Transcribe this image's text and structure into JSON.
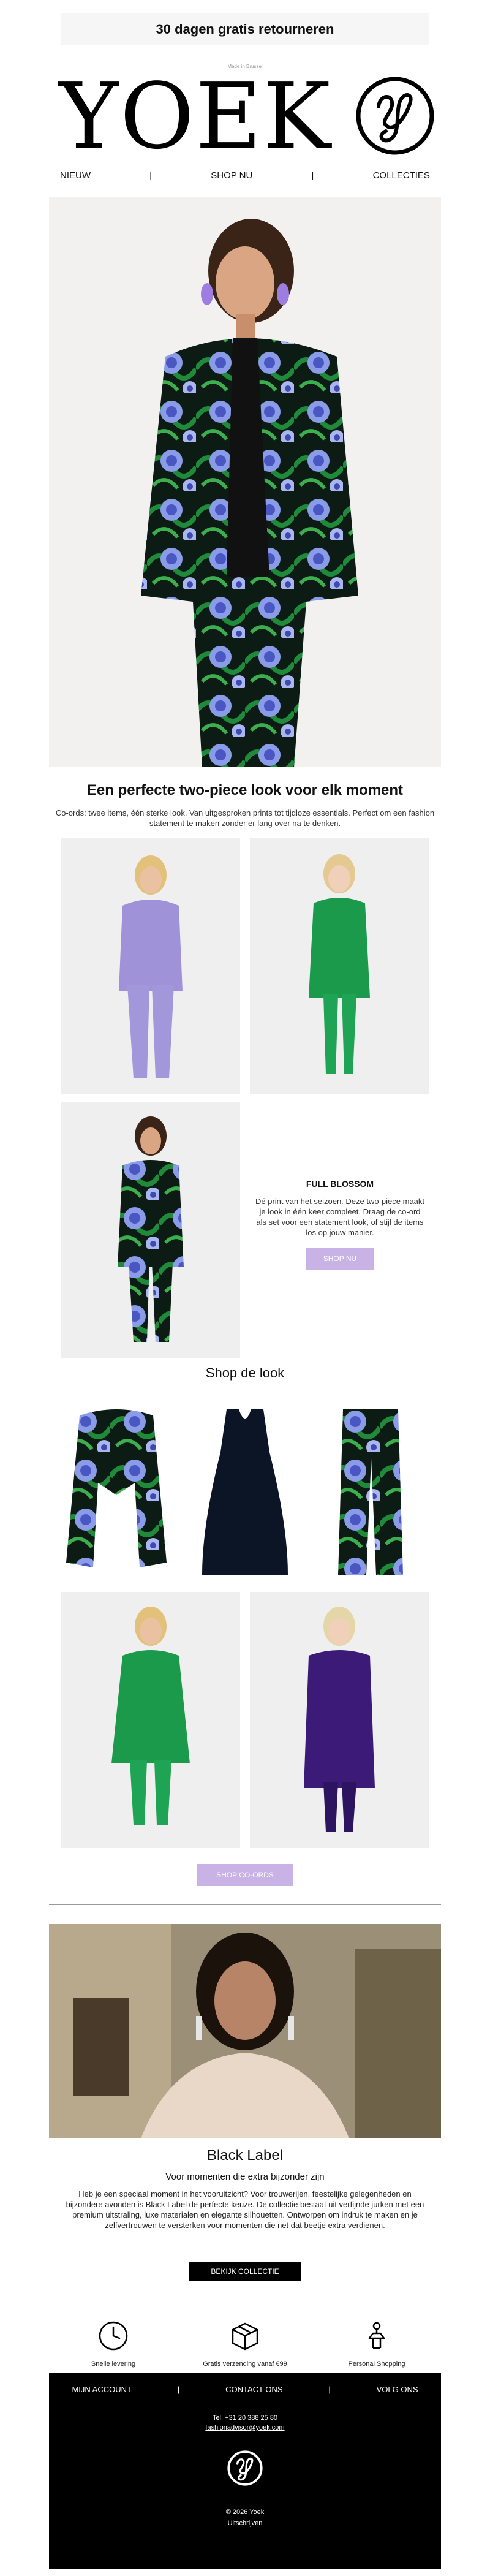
{
  "banner": {
    "text": "30 dagen gratis retourneren"
  },
  "brand": {
    "made_in": "Made in Brussel",
    "wordmark": "YOEK"
  },
  "nav": {
    "items": [
      "NIEUW",
      "SHOP NU",
      "COLLECTIES"
    ],
    "separator": "|"
  },
  "hero": {
    "title": "Een perfecte two-piece look voor elk moment",
    "text": "Co-ords: twee items, één sterke look. Van uitgesproken prints tot tijdloze essentials. Perfect om een fashion statement te maken zonder er lang over na te denken."
  },
  "full_blossom": {
    "title": "FULL BLOSSOM",
    "text": "Dé print van het seizoen. Deze two-piece maakt je look in één keer compleet. Draag de co-ord als set voor een statement look, of stijl de items los op jouw manier.",
    "button": "SHOP NU"
  },
  "shop_the_look": {
    "title": "Shop de look"
  },
  "coords_button": "SHOP CO-ORDS",
  "black_label": {
    "title": "Black Label",
    "subtitle": "Voor momenten die extra bijzonder zijn",
    "text": "Heb je een speciaal moment in het vooruitzicht? Voor trouwerijen, feestelijke gelegenheden en bijzondere avonden is Black Label de perfecte keuze. De collectie bestaat uit verfijnde jurken met een premium uitstraling, luxe materialen en elegante silhouetten. Ontworpen om indruk te maken en je zelfvertrouwen te versterken voor momenten die net dat beetje extra verdienen.",
    "button": "BEKIJK COLLECTIE"
  },
  "usps": [
    {
      "label": "Snelle levering",
      "icon": "clock-icon"
    },
    {
      "label": "Gratis verzending vanaf €99",
      "icon": "package-icon"
    },
    {
      "label": "Personal Shopping",
      "icon": "hanger-icon"
    }
  ],
  "footer": {
    "nav": [
      "MIJN ACCOUNT",
      "CONTACT ONS",
      "VOLG ONS"
    ],
    "phone": "Tel. +31 20 388 25 80",
    "email": "fashionadvisor@yoek.com",
    "copyright": "© 2026 Yoek",
    "unsubscribe": "Uitschrijven"
  },
  "colors": {
    "lilac": "#c9b3e6",
    "black": "#000000",
    "banner_bg": "#f6f6f6",
    "green": "#1a9a4a",
    "lavender": "#9f92d8",
    "purple": "#3b1a78"
  }
}
